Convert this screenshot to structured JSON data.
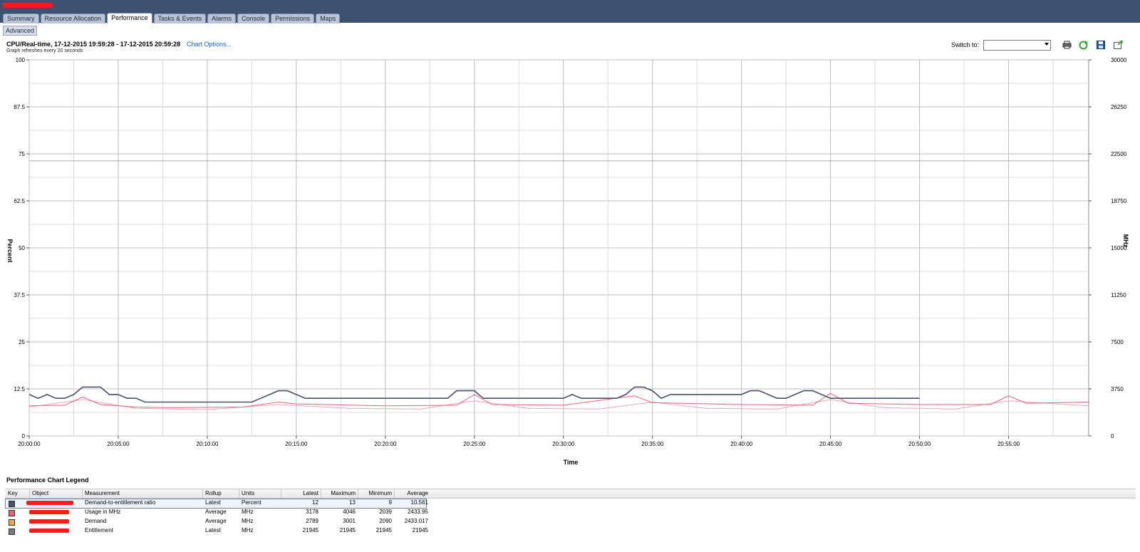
{
  "tabs": [
    {
      "label": "Summary"
    },
    {
      "label": "Resource Allocation"
    },
    {
      "label": "Performance"
    },
    {
      "label": "Tasks & Events"
    },
    {
      "label": "Alarms"
    },
    {
      "label": "Console"
    },
    {
      "label": "Permissions"
    },
    {
      "label": "Maps"
    }
  ],
  "active_tab": "Performance",
  "subtab": "Advanced",
  "header": {
    "title": "CPU/Real-time, 17-12-2015 19:59:28 - 17-12-2015 20:59:28",
    "chart_options": "Chart Options...",
    "refresh_note": "Graph refreshes every 20 seconds",
    "switch_to_label": "Switch to:",
    "switch_to_value": ""
  },
  "toolbar_icons": [
    "print-icon",
    "refresh-icon",
    "save-icon",
    "popout-icon"
  ],
  "chart_data": {
    "type": "line",
    "xlabel": "Time",
    "ylabel_left": "Percent",
    "ylabel_right": "MHz",
    "ylim_left": [
      0,
      100
    ],
    "ylim_right": [
      0,
      30000
    ],
    "yticks_left": [
      "0",
      "12.5",
      "25",
      "37.5",
      "50",
      "62.5",
      "75",
      "87.5",
      "100"
    ],
    "yticks_right": [
      "0",
      "3750",
      "7500",
      "11250",
      "15000",
      "18750",
      "22500",
      "26250",
      "30000"
    ],
    "xticks": [
      "20:00:00",
      "20:05:00",
      "20:10:00",
      "20:15:00",
      "20:20:00",
      "20:25:00",
      "20:30:00",
      "20:35:00",
      "20:40:00",
      "20:45:00",
      "20:50:00",
      "20:55:00"
    ],
    "x_range_minutes": [
      0,
      59.5
    ],
    "grid": true,
    "series": [
      {
        "name": "Demand-to-entitlement ratio",
        "axis": "left",
        "color": "#4a5168",
        "points": [
          [
            0,
            11
          ],
          [
            0.5,
            10
          ],
          [
            1,
            11
          ],
          [
            1.5,
            10
          ],
          [
            2,
            10
          ],
          [
            2.5,
            11
          ],
          [
            3,
            13
          ],
          [
            3.5,
            13
          ],
          [
            4,
            13
          ],
          [
            4.5,
            11
          ],
          [
            5,
            11
          ],
          [
            5.5,
            10
          ],
          [
            6,
            10
          ],
          [
            6.5,
            9
          ],
          [
            7,
            9
          ],
          [
            7.5,
            9
          ],
          [
            8,
            9
          ],
          [
            8.5,
            9
          ],
          [
            9,
            9
          ],
          [
            9.5,
            9
          ],
          [
            10,
            9
          ],
          [
            10.5,
            9
          ],
          [
            11,
            9
          ],
          [
            11.5,
            9
          ],
          [
            12,
            9
          ],
          [
            12.5,
            9
          ],
          [
            13,
            10
          ],
          [
            13.5,
            11
          ],
          [
            14,
            12
          ],
          [
            14.5,
            12
          ],
          [
            15,
            11
          ],
          [
            15.5,
            10
          ],
          [
            16,
            10
          ],
          [
            16.5,
            10
          ],
          [
            17,
            10
          ],
          [
            17.5,
            10
          ],
          [
            18,
            10
          ],
          [
            18.5,
            10
          ],
          [
            19,
            10
          ],
          [
            19.5,
            10
          ],
          [
            20,
            10
          ],
          [
            20.5,
            10
          ],
          [
            21,
            10
          ],
          [
            21.5,
            10
          ],
          [
            22,
            10
          ],
          [
            22.5,
            10
          ],
          [
            23,
            10
          ],
          [
            23.5,
            10
          ],
          [
            24,
            12
          ],
          [
            24.5,
            12
          ],
          [
            25,
            12
          ],
          [
            25.5,
            10
          ],
          [
            26,
            10
          ],
          [
            26.5,
            10
          ],
          [
            27,
            10
          ],
          [
            27.5,
            10
          ],
          [
            28,
            10
          ],
          [
            28.5,
            10
          ],
          [
            29,
            10
          ],
          [
            29.5,
            10
          ],
          [
            30,
            10
          ],
          [
            30.5,
            11
          ],
          [
            31,
            10
          ],
          [
            31.5,
            10
          ],
          [
            32,
            10
          ],
          [
            32.5,
            10
          ],
          [
            33,
            10
          ],
          [
            33.5,
            11
          ],
          [
            34,
            13
          ],
          [
            34.5,
            13
          ],
          [
            35,
            12
          ],
          [
            35.5,
            10
          ],
          [
            36,
            11
          ],
          [
            36.5,
            11
          ],
          [
            37,
            11
          ],
          [
            37.5,
            11
          ],
          [
            38,
            11
          ],
          [
            38.5,
            11
          ],
          [
            39,
            11
          ],
          [
            39.5,
            11
          ],
          [
            40,
            11
          ],
          [
            40.5,
            12
          ],
          [
            41,
            12
          ],
          [
            41.5,
            11
          ],
          [
            42,
            10
          ],
          [
            42.5,
            10
          ],
          [
            43,
            11
          ],
          [
            43.5,
            12
          ],
          [
            44,
            12
          ],
          [
            44.5,
            11
          ],
          [
            45,
            10
          ],
          [
            45.5,
            10
          ],
          [
            46,
            10
          ],
          [
            46.5,
            10
          ],
          [
            47,
            10
          ],
          [
            47.5,
            10
          ],
          [
            48,
            10
          ],
          [
            48.5,
            10
          ],
          [
            49,
            10
          ],
          [
            49.5,
            10
          ],
          [
            50,
            10
          ]
        ],
        "note": "values in percent, minute offsets from 20:00:00"
      },
      {
        "name": "Usage in MHz",
        "axis": "right",
        "color": "#e8637a",
        "points": [
          [
            0,
            2400
          ],
          [
            2,
            2450
          ],
          [
            3,
            3100
          ],
          [
            4,
            2500
          ],
          [
            6,
            2300
          ],
          [
            8,
            2250
          ],
          [
            12,
            2300
          ],
          [
            14,
            2700
          ],
          [
            15,
            2550
          ],
          [
            20,
            2400
          ],
          [
            24,
            2450
          ],
          [
            25,
            3300
          ],
          [
            26,
            2500
          ],
          [
            30,
            2450
          ],
          [
            34,
            3200
          ],
          [
            35,
            2650
          ],
          [
            40,
            2500
          ],
          [
            44,
            2450
          ],
          [
            45,
            3400
          ],
          [
            46,
            2600
          ],
          [
            50,
            2500
          ],
          [
            54,
            2500
          ],
          [
            55,
            3200
          ],
          [
            56,
            2600
          ],
          [
            59.5,
            2700
          ]
        ]
      },
      {
        "name": "Demand",
        "axis": "right",
        "color": "#f0a5b2",
        "points": [
          [
            0,
            2300
          ],
          [
            3,
            2900
          ],
          [
            6,
            2200
          ],
          [
            10,
            2100
          ],
          [
            14,
            2500
          ],
          [
            18,
            2200
          ],
          [
            22,
            2150
          ],
          [
            25,
            2800
          ],
          [
            28,
            2200
          ],
          [
            32,
            2150
          ],
          [
            35,
            2700
          ],
          [
            38,
            2200
          ],
          [
            42,
            2150
          ],
          [
            45,
            2900
          ],
          [
            48,
            2250
          ],
          [
            52,
            2150
          ],
          [
            55,
            2800
          ],
          [
            59.5,
            2400
          ]
        ]
      },
      {
        "name": "Entitlement",
        "axis": "right",
        "color": "#7a7a7a",
        "points": [
          [
            0,
            21945
          ],
          [
            59.5,
            21945
          ]
        ]
      }
    ]
  },
  "legend": {
    "title": "Performance Chart Legend",
    "columns": [
      "Key",
      "Object",
      "Measurement",
      "Rollup",
      "Units",
      "Latest",
      "Maximum",
      "Minimum",
      "Average"
    ],
    "rows": [
      {
        "key_color": "#4a5168",
        "measurement": "Demand-to-entitlement ratio",
        "rollup": "Latest",
        "units": "Percent",
        "latest": "12",
        "maximum": "13",
        "minimum": "9",
        "average": "10.561"
      },
      {
        "key_color": "#e8637a",
        "measurement": "Usage in MHz",
        "rollup": "Average",
        "units": "MHz",
        "latest": "3178",
        "maximum": "4046",
        "minimum": "2039",
        "average": "2433.95"
      },
      {
        "key_color": "#e9a654",
        "measurement": "Demand",
        "rollup": "Average",
        "units": "MHz",
        "latest": "2789",
        "maximum": "3001",
        "minimum": "2090",
        "average": "2433.017"
      },
      {
        "key_color": "#7a7a7a",
        "measurement": "Entitlement",
        "rollup": "Latest",
        "units": "MHz",
        "latest": "21945",
        "maximum": "21945",
        "minimum": "21945",
        "average": "21945"
      }
    ]
  }
}
